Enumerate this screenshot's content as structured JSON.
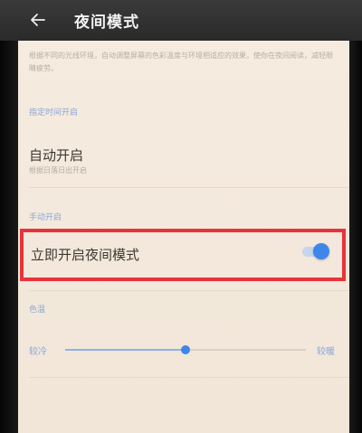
{
  "appbar": {
    "title": "夜间模式",
    "back_icon": "arrow-left-icon"
  },
  "description": "根据不同的光线环境，自动调整屏幕的色彩温度与环境相适应的效果，使你在夜间阅读，减轻眼睛疲劳。",
  "schedule": {
    "header": "指定时间开启",
    "item_title": "自动开启",
    "item_sub": "根据日落日出开启"
  },
  "manual": {
    "header": "手动开启",
    "item_title": "立即开启夜间模式",
    "toggle_on": true
  },
  "color_temp": {
    "header": "色温",
    "min_label": "较冷",
    "max_label": "较暖",
    "value_fraction": 0.5
  },
  "colors": {
    "accent": "#3f86ea",
    "highlight_border": "#e8333a",
    "screen_tint": "#f4e9dc"
  }
}
